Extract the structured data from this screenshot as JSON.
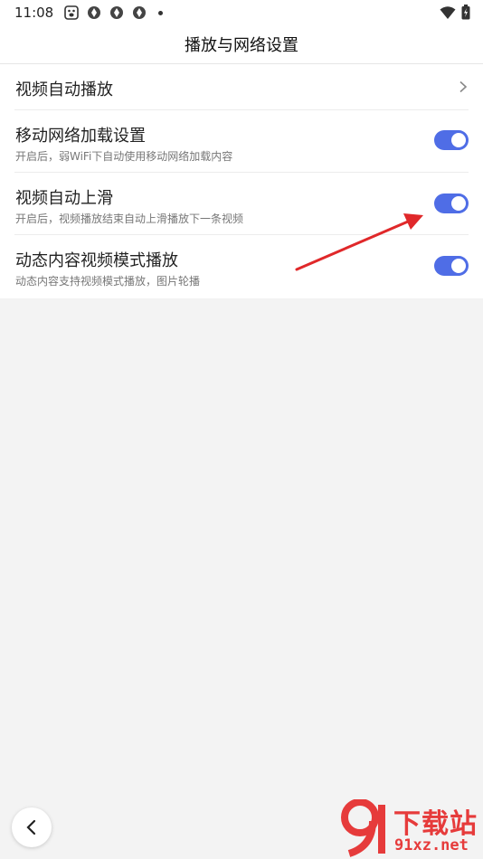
{
  "status_bar": {
    "time": "11:08",
    "icons": [
      "baidu-paw-icon",
      "app-icon",
      "app-icon",
      "app-icon",
      "more-dot-icon"
    ],
    "right_icons": [
      "wifi-icon",
      "battery-charging-icon"
    ]
  },
  "header": {
    "title": "播放与网络设置"
  },
  "settings": {
    "rows": [
      {
        "title": "视频自动播放",
        "type": "link"
      },
      {
        "title": "移动网络加载设置",
        "subtitle": "开启后，弱WiFi下自动使用移动网络加载内容",
        "type": "toggle",
        "on": true
      },
      {
        "title": "视频自动上滑",
        "subtitle": "开启后，视频播放结束自动上滑播放下一条视频",
        "type": "toggle",
        "on": true
      },
      {
        "title": "动态内容视频模式播放",
        "subtitle": "动态内容支持视频模式播放，图片轮播",
        "type": "toggle",
        "on": true
      }
    ]
  },
  "nav": {
    "back_icon": "chevron-left-icon"
  },
  "watermark": {
    "line1": "下载站",
    "line2": "91xz.net"
  },
  "colors": {
    "accent": "#4f6de6",
    "annotation_arrow": "#e0282a",
    "watermark": "#e63b3b"
  }
}
